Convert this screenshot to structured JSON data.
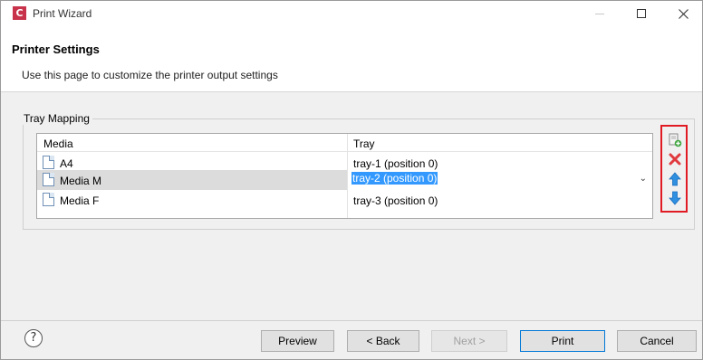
{
  "window": {
    "app_icon_letter": "C",
    "title": "Print Wizard",
    "controls": {
      "minimize": "—",
      "maximize": "",
      "close": "✕"
    }
  },
  "header": {
    "title": "Printer Settings",
    "description": "Use this page to customize the printer output settings"
  },
  "tray_mapping": {
    "group_label": "Tray Mapping",
    "columns": {
      "media": "Media",
      "tray": "Tray"
    },
    "rows": [
      {
        "media": "A4",
        "tray": "tray-1 (position 0)",
        "selected": false
      },
      {
        "media": "Media M",
        "tray": "tray-2 (position 0)",
        "selected": true
      },
      {
        "media": "Media F",
        "tray": "tray-3 (position 0)",
        "selected": false
      }
    ],
    "tray_dropdown_chevron": "⌄",
    "tools": [
      {
        "name": "add-media-icon"
      },
      {
        "name": "delete-icon"
      },
      {
        "name": "move-up-icon"
      },
      {
        "name": "move-down-icon"
      }
    ],
    "highlight_color": "#e01b24"
  },
  "footer": {
    "help": "?",
    "buttons": {
      "preview": "Preview",
      "back": "< Back",
      "next": "Next >",
      "print": "Print",
      "cancel": "Cancel"
    }
  },
  "colors": {
    "selection": "#3399ff",
    "app_icon": "#c8334b",
    "default_button_border": "#0078d7"
  }
}
